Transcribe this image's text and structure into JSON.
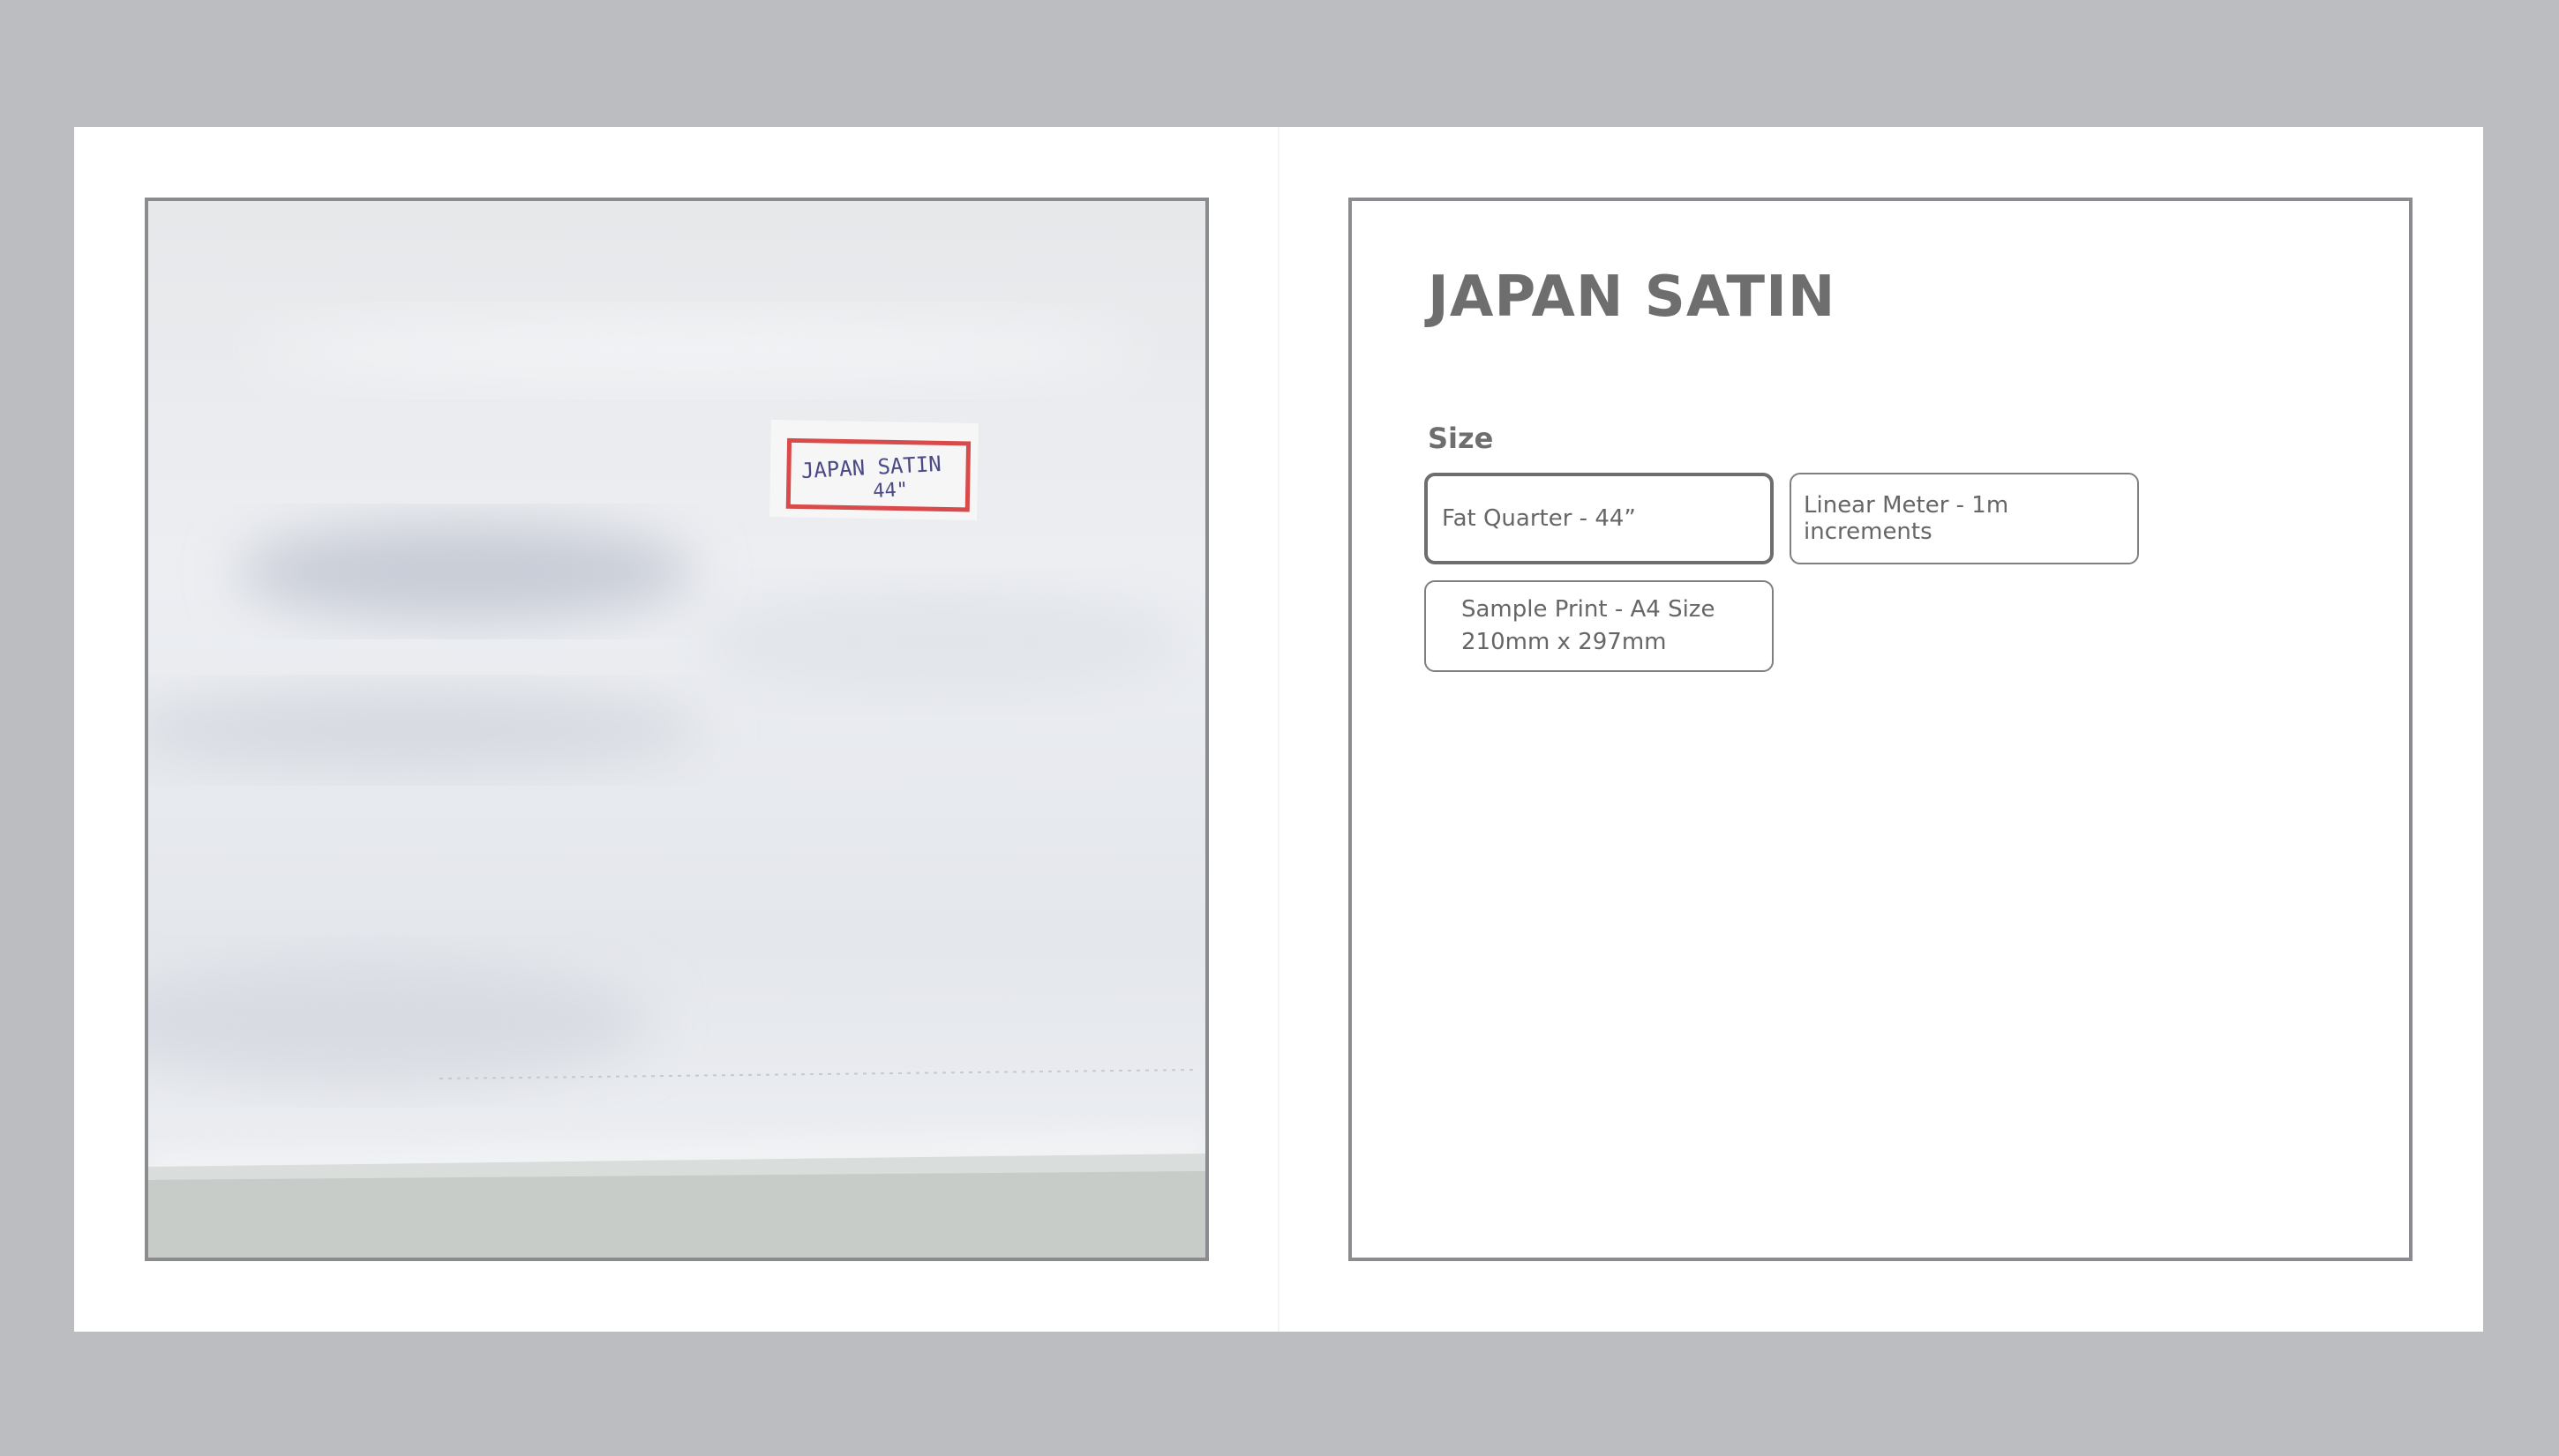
{
  "product": {
    "title": "JAPAN SATIN",
    "image_label_text": "JAPAN SATIN 44\""
  },
  "size": {
    "label": "Size",
    "options": [
      {
        "label": "Fat Quarter - 44”",
        "selected": true
      },
      {
        "label": "Linear Meter - 1m increments",
        "selected": false
      },
      {
        "label_line1": "Sample Print - A4 Size",
        "label_line2": "210mm x 297mm",
        "selected": false
      }
    ]
  },
  "colors": {
    "page_background": "#bcbdc0",
    "card_background": "#ffffff",
    "frame_border": "#8b8c8f",
    "text": "#6e6e6e"
  }
}
